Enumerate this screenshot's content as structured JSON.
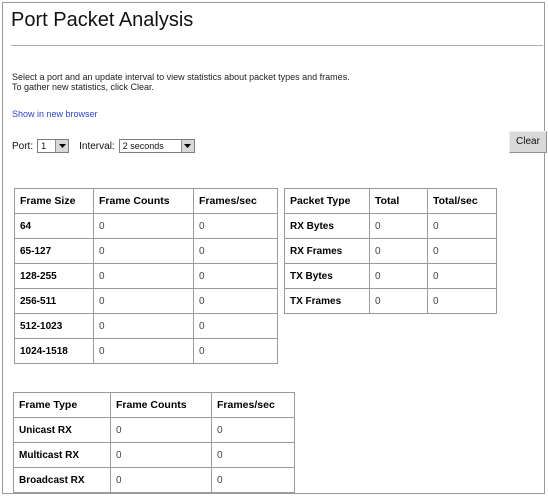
{
  "title": "Port Packet Analysis",
  "description": {
    "line1": "Select a port and an update interval to view statistics about packet types and frames.",
    "line2": "To gather new statistics, click Clear."
  },
  "show_in_new_browser": "Show in new browser",
  "controls": {
    "port_label": "Port:",
    "port_value": "1",
    "interval_label": "Interval:",
    "interval_value": "2 seconds"
  },
  "clear_button": "Clear",
  "frame_size_table": {
    "headers": [
      "Frame Size",
      "Frame Counts",
      "Frames/sec"
    ],
    "rows": [
      {
        "key": "64",
        "counts": "0",
        "rate": "0"
      },
      {
        "key": "65-127",
        "counts": "0",
        "rate": "0"
      },
      {
        "key": "128-255",
        "counts": "0",
        "rate": "0"
      },
      {
        "key": "256-511",
        "counts": "0",
        "rate": "0"
      },
      {
        "key": "512-1023",
        "counts": "0",
        "rate": "0"
      },
      {
        "key": "1024-1518",
        "counts": "0",
        "rate": "0"
      }
    ]
  },
  "packet_type_table": {
    "headers": [
      "Packet Type",
      "Total",
      "Total/sec"
    ],
    "rows": [
      {
        "key": "RX Bytes",
        "total": "0",
        "rate": "0"
      },
      {
        "key": "RX Frames",
        "total": "0",
        "rate": "0"
      },
      {
        "key": "TX Bytes",
        "total": "0",
        "rate": "0"
      },
      {
        "key": "TX Frames",
        "total": "0",
        "rate": "0"
      }
    ]
  },
  "frame_type_table": {
    "headers": [
      "Frame Type",
      "Frame Counts",
      "Frames/sec"
    ],
    "rows": [
      {
        "key": "Unicast RX",
        "counts": "0",
        "rate": "0"
      },
      {
        "key": "Multicast RX",
        "counts": "0",
        "rate": "0"
      },
      {
        "key": "Broadcast RX",
        "counts": "0",
        "rate": "0"
      }
    ]
  }
}
